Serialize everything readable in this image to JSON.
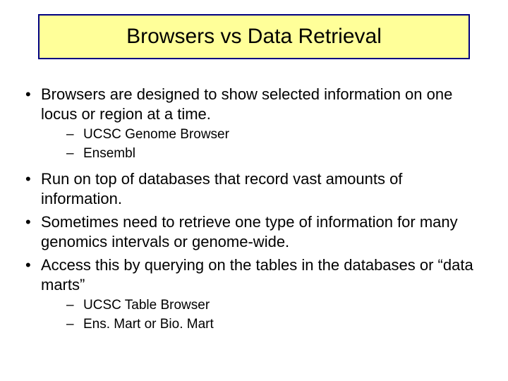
{
  "title": "Browsers vs Data Retrieval",
  "bullets": {
    "b1": "Browsers are designed to show selected information on one locus or region at a time.",
    "b1_sub1": "UCSC Genome Browser",
    "b1_sub2": "Ensembl",
    "b2": "Run on top of databases that record vast amounts of information.",
    "b3": "Sometimes need to retrieve one type of information for many genomics intervals or genome-wide.",
    "b4": "Access this by querying on the tables in the databases or “data marts”",
    "b4_sub1": "UCSC Table Browser",
    "b4_sub2": "Ens. Mart or Bio. Mart"
  }
}
